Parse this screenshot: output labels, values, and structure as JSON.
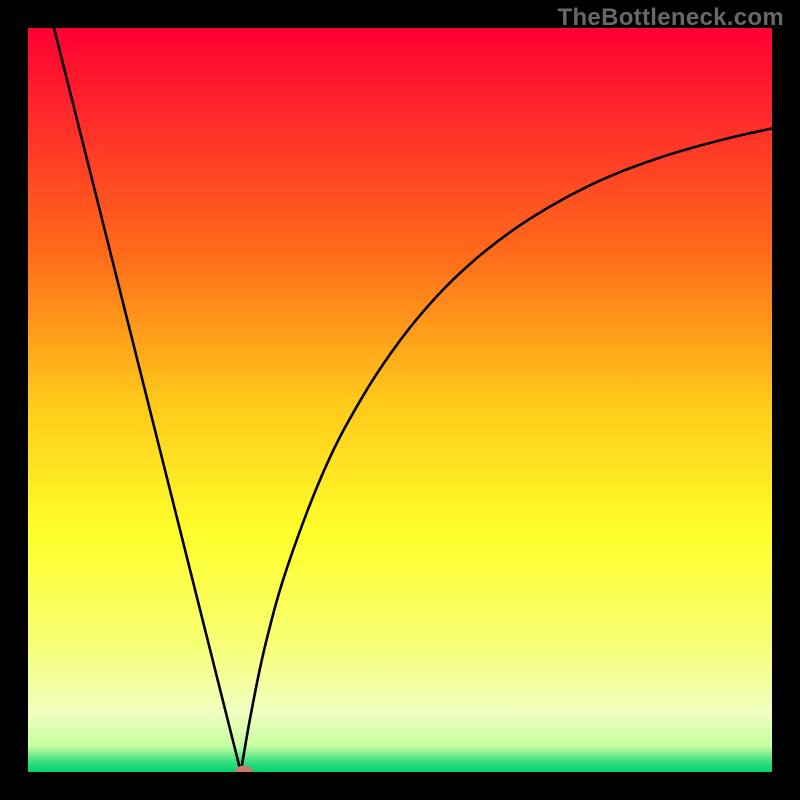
{
  "watermark": "TheBottleneck.com",
  "chart_data": {
    "type": "line",
    "title": "",
    "xlabel": "",
    "ylabel": "",
    "xlim": [
      0,
      1
    ],
    "ylim": [
      0,
      1
    ],
    "background": "rainbow-vertical-gradient",
    "gradient_stops": [
      {
        "pos": 0.0,
        "color": "#ff0033"
      },
      {
        "pos": 0.12,
        "color": "#ff2a2a"
      },
      {
        "pos": 0.3,
        "color": "#ff6a1a"
      },
      {
        "pos": 0.5,
        "color": "#ffc81a"
      },
      {
        "pos": 0.68,
        "color": "#ffff2a"
      },
      {
        "pos": 0.82,
        "color": "#f8ff70"
      },
      {
        "pos": 0.92,
        "color": "#f0ffc0"
      },
      {
        "pos": 0.965,
        "color": "#c8ffa0"
      },
      {
        "pos": 0.985,
        "color": "#40e080"
      },
      {
        "pos": 1.0,
        "color": "#00d070"
      }
    ],
    "series": [
      {
        "name": "v-curve-left",
        "x": [
          0.035,
          0.286
        ],
        "y": [
          1.0,
          0.0
        ],
        "note": "left branch is essentially a straight steep line"
      },
      {
        "name": "v-curve-right",
        "x": [
          0.286,
          0.3,
          0.32,
          0.35,
          0.4,
          0.45,
          0.5,
          0.55,
          0.6,
          0.65,
          0.7,
          0.75,
          0.8,
          0.85,
          0.9,
          0.95,
          1.0
        ],
        "y": [
          0.0,
          0.08,
          0.175,
          0.28,
          0.41,
          0.505,
          0.58,
          0.64,
          0.688,
          0.727,
          0.759,
          0.786,
          0.808,
          0.826,
          0.841,
          0.854,
          0.865
        ],
        "note": "right branch is a concave diminishing curve"
      }
    ],
    "marker": {
      "x": 0.29,
      "y": 0.0,
      "color": "#c97a6a",
      "rx": 9,
      "ry": 6.5
    }
  }
}
